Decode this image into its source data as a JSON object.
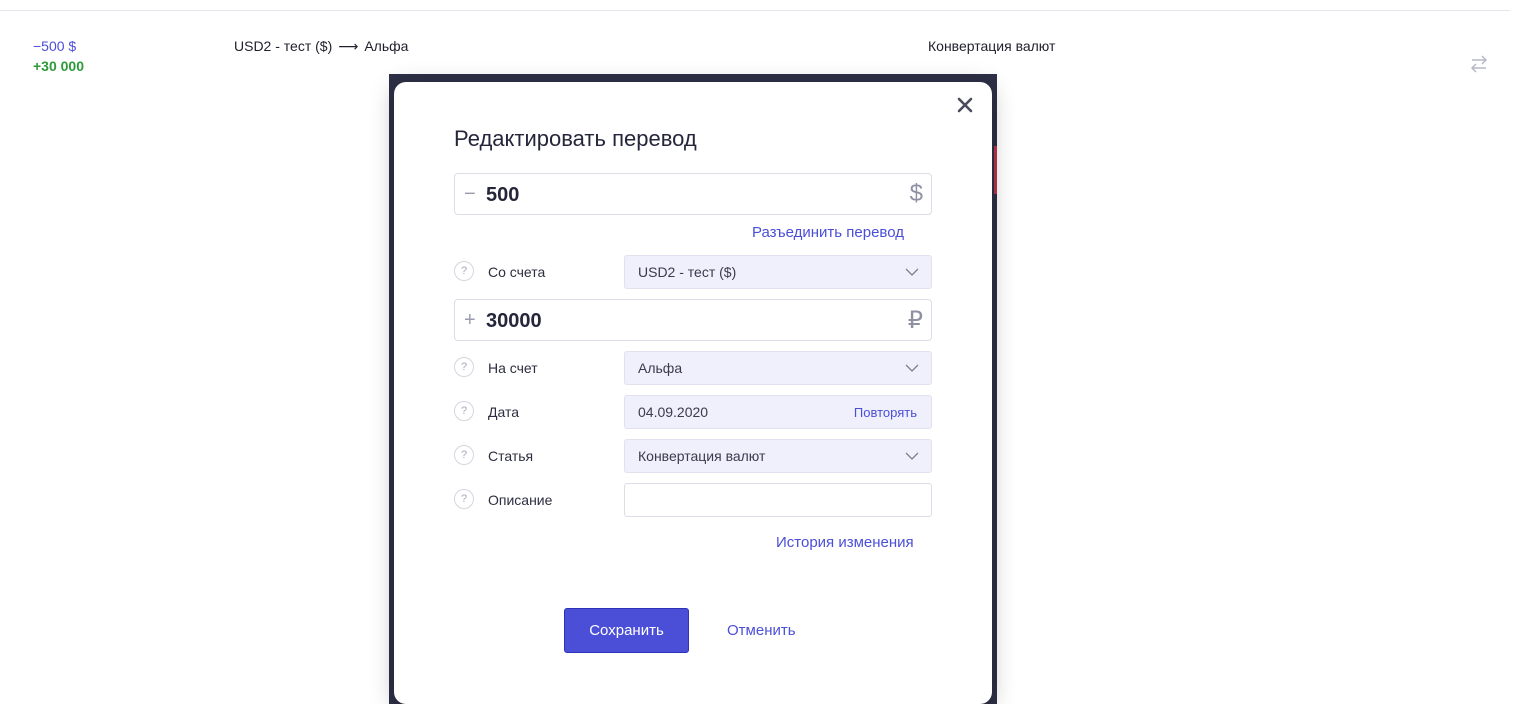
{
  "transaction": {
    "amount_out": "−500 $",
    "amount_in": "+30 000",
    "from_account": "USD2 - тест ($)",
    "arrow": "⟶",
    "to_account": "Альфа",
    "category": "Конвертация валют",
    "type_icon": "transfer-arrows-icon"
  },
  "modal": {
    "title": "Редактировать перевод",
    "close_icon": "close-icon",
    "amount_from": {
      "sign": "−",
      "value": "500",
      "currency": "$"
    },
    "split_link": "Разъединить перевод",
    "from_field": {
      "label": "Со счета",
      "value": "USD2 - тест ($)"
    },
    "amount_to": {
      "sign": "+",
      "value": "30000",
      "currency": "₽"
    },
    "to_field": {
      "label": "На счет",
      "value": "Альфа"
    },
    "date_field": {
      "label": "Дата",
      "value": "04.09.2020",
      "repeat": "Повторять"
    },
    "category_field": {
      "label": "Статья",
      "value": "Конвертация валют"
    },
    "description_field": {
      "label": "Описание",
      "value": ""
    },
    "history_link": "История изменения",
    "save_label": "Сохранить",
    "cancel_label": "Отменить",
    "help_glyph": "?"
  },
  "colors": {
    "accent": "#4b4fd8",
    "income": "#2e9a39",
    "field_bg": "#eff0fb",
    "backdrop": "#2e3047"
  }
}
